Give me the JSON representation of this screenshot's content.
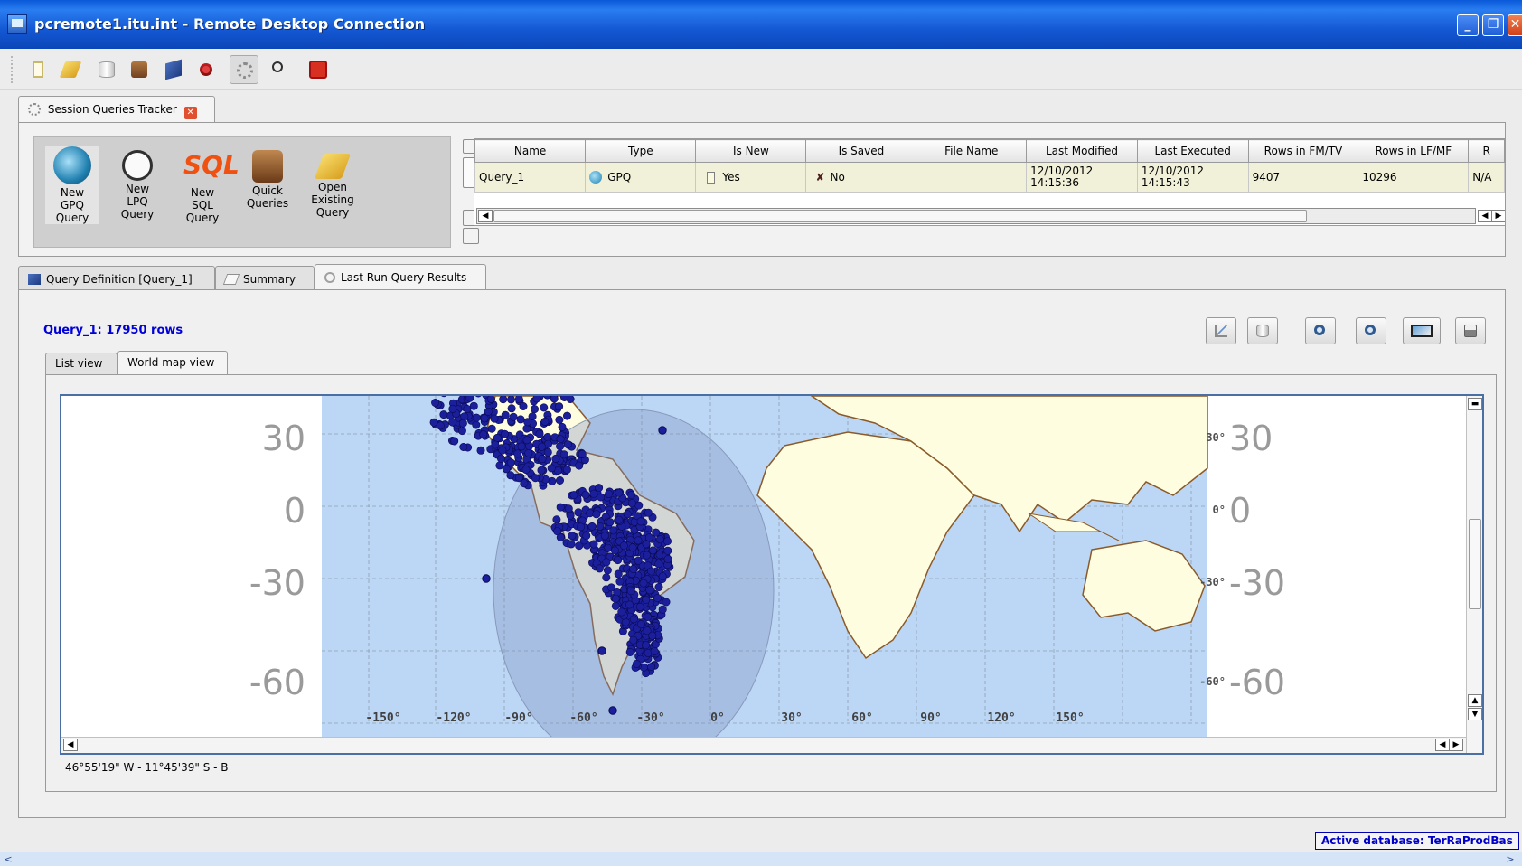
{
  "window": {
    "title": "pcremote1.itu.int - Remote Desktop Connection",
    "minimize": "_",
    "restore": "❐",
    "close": "✕"
  },
  "toolbar": {
    "icons": [
      "new-file-icon",
      "open-folder-icon",
      "database-icon",
      "box-icon",
      "book-icon",
      "plug-icon",
      "gears-icon",
      "clock-grid-icon",
      "power-icon"
    ]
  },
  "tracker": {
    "tab_label": "Session Queries Tracker",
    "launchers": [
      {
        "label": "New\nGPQ\nQuery",
        "icon": "gpq-query-icon"
      },
      {
        "label": "New\nLPQ\nQuery",
        "icon": "lpq-query-icon"
      },
      {
        "label": "New\nSQL\nQuery",
        "icon": "sql-query-icon"
      },
      {
        "label": "Quick\nQueries",
        "icon": "quick-queries-icon"
      },
      {
        "label": "Open\nExisting\nQuery",
        "icon": "open-folder-icon"
      }
    ],
    "columns": [
      "Name",
      "Type",
      "Is New",
      "Is Saved",
      "File Name",
      "Last Modified",
      "Last Executed",
      "Rows in FM/TV",
      "Rows in LF/MF",
      "R"
    ],
    "rows": [
      {
        "name": "Query_1",
        "type": "GPQ",
        "is_new": "Yes",
        "is_saved": "No",
        "file_name": "",
        "last_modified": "12/10/2012\n14:15:36",
        "last_executed": "12/10/2012\n14:15:43",
        "rows_fm_tv": "9407",
        "rows_lf_mf": "10296",
        "r": "N/A"
      }
    ]
  },
  "query_tabs": [
    {
      "label": "Query Definition [Query_1]",
      "icon": "book-icon"
    },
    {
      "label": "Summary",
      "icon": "checklist-icon"
    },
    {
      "label": "Last Run Query Results",
      "icon": "magnifier-icon"
    }
  ],
  "results": {
    "title": "Query_1: 17950 rows",
    "view_tabs": [
      "List view",
      "World map view"
    ],
    "tool_icons": [
      "chart-icon",
      "database-icon",
      "zoom-in-icon",
      "zoom-out-icon",
      "map-frame-icon",
      "print-icon"
    ],
    "coord_readout": "46°55'19\" W - 11°45'39\" S - B"
  },
  "map": {
    "lat_labels": [
      "30",
      "0",
      "-30",
      "-60"
    ],
    "lat_labels_right_small": [
      "30°",
      "0°",
      "-30°",
      "-60°"
    ],
    "lon_labels": [
      "-150°",
      "-120°",
      "-90°",
      "-60°",
      "-30°",
      "0°",
      "30°",
      "60°",
      "90°",
      "120°",
      "150°"
    ],
    "colors": {
      "ocean": "#bcd7f5",
      "land": "#fffde0",
      "coast": "#8a5a2a",
      "points": "#1b1f9c",
      "grid": "#8e9fb0"
    }
  },
  "status": {
    "active_db": "Active database: TerRaProdBas"
  }
}
